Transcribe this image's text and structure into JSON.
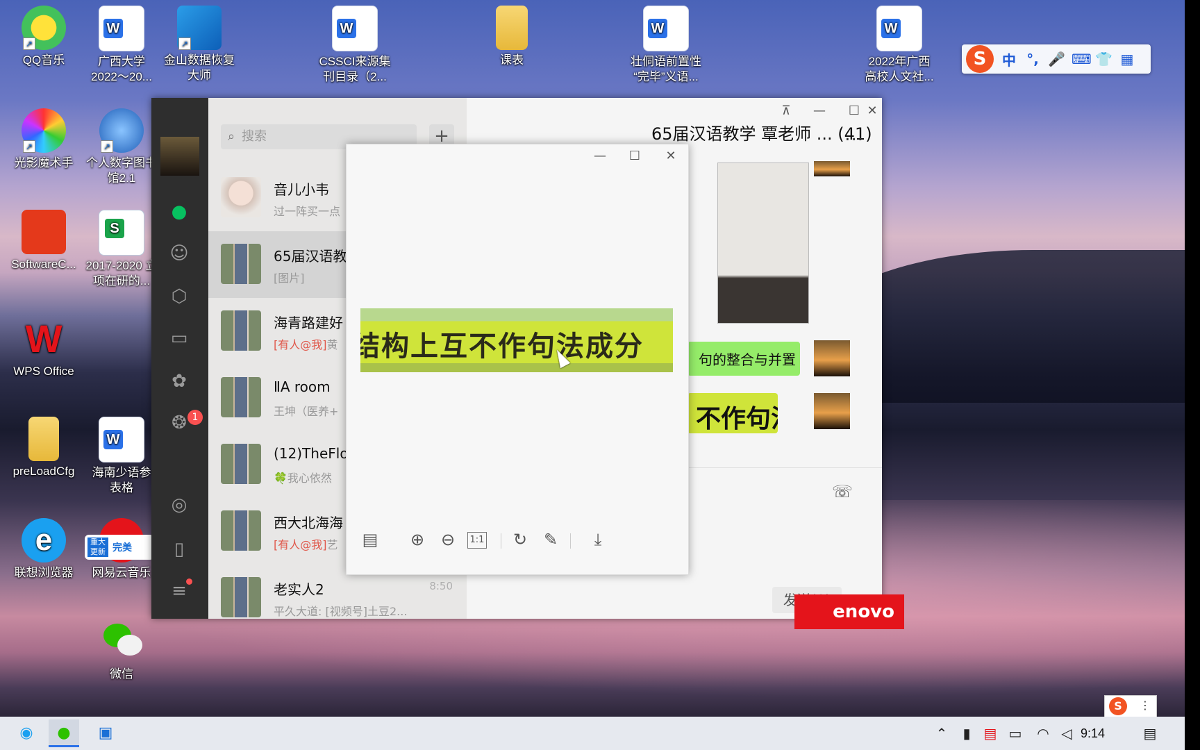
{
  "desktop": {
    "icons": [
      {
        "label": "QQ音乐"
      },
      {
        "label": "广西大学 2022～20..."
      },
      {
        "label": "金山数据恢复 大师"
      },
      {
        "label": "CSSCI来源集 刊目录（2..."
      },
      {
        "label": "课表"
      },
      {
        "label": "壮侗语前置性 “完毕”义语..."
      },
      {
        "label": "2022年广西 高校人文社..."
      },
      {
        "label": "光影魔术手"
      },
      {
        "label": "个人数字图书 馆2.1"
      },
      {
        "label": "SoftwareC..."
      },
      {
        "label": "2017-2020 立项在研的..."
      },
      {
        "label": "WPS Office"
      },
      {
        "label": "preLoadCfg"
      },
      {
        "label": "海南少语参 表格"
      },
      {
        "label": "联想浏览器"
      },
      {
        "label": "网易云音乐"
      },
      {
        "label": "微信"
      }
    ],
    "update_badge": "重大 更新",
    "update_badge_text": "完美"
  },
  "ime": {
    "lang": "中",
    "punct": "°,",
    "mic": "🎤",
    "keyboard": "⌨",
    "skin": "👕",
    "grid": "▦"
  },
  "wechat": {
    "search_placeholder": "搜索",
    "add_label": "+",
    "unread_badge": "1",
    "chats": [
      {
        "name": "音儿小韦",
        "msg": "过一阵买一点",
        "time": ""
      },
      {
        "name": "65届汉语教",
        "msg": "[图片]",
        "time": ""
      },
      {
        "name": "海青路建好",
        "at": "[有人@我]",
        "msg": "黄",
        "time": ""
      },
      {
        "name": "ⅡA room",
        "msg": "王坤（医养+",
        "time": ""
      },
      {
        "name": "(12)TheFlo",
        "msg": "🍀我心依然",
        "time": ""
      },
      {
        "name": "西大北海海",
        "at": "[有人@我]",
        "msg": "艺",
        "time": ""
      },
      {
        "name": "老实人2",
        "msg": "平久大道: [视频号]土豆2...",
        "time": "8:50"
      }
    ],
    "chat_title": "65届汉语教学 覃老师 ... (41)",
    "more": "...",
    "messages": [
      {
        "text": "句的整合与并置"
      },
      {
        "text": "不作句法"
      }
    ],
    "send_label": "发送(S)",
    "window_controls": {
      "pin": "⊼",
      "min": "—",
      "max": "☐",
      "close": "✕"
    }
  },
  "viewer": {
    "controls": {
      "min": "—",
      "max": "☐",
      "close": "✕"
    },
    "image_text": "结构上互不作句法成分",
    "tools": {
      "grid": "▤",
      "zoom_in": "⊕",
      "zoom_out": "⊖",
      "actual": "1:1",
      "rotate": "↻",
      "edit": "✎",
      "download": "⤓"
    }
  },
  "lenovo": "enovo",
  "taskbar": {
    "time": "9:14"
  }
}
